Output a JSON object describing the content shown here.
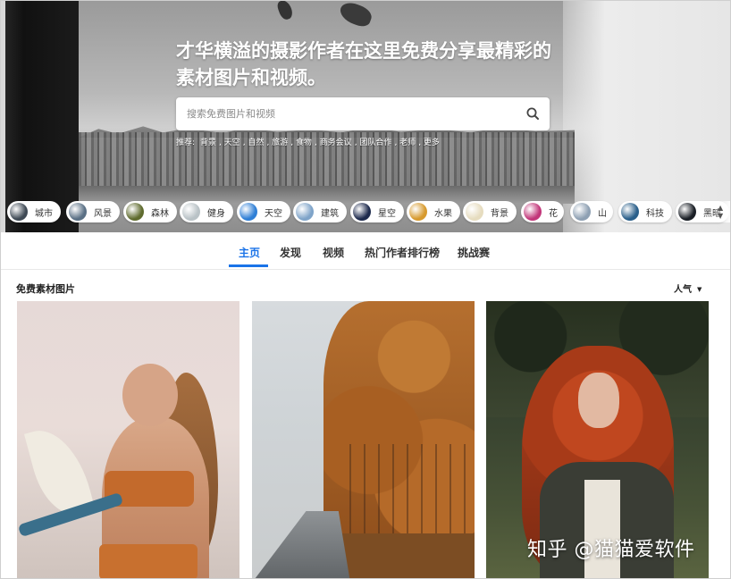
{
  "hero": {
    "title": "才华横溢的摄影作者在这里免费分享最精彩的素材图片和视频。"
  },
  "search": {
    "placeholder": "搜索免费图片和视频",
    "value": ""
  },
  "suggestions": {
    "prefix": "推荐:",
    "items": [
      "背景",
      "天空",
      "自然",
      "旅游",
      "食物",
      "商务会议",
      "团队合作",
      "老师",
      "更多"
    ]
  },
  "categories": [
    {
      "label": "城市",
      "color": "#3f4a55"
    },
    {
      "label": "风景",
      "color": "#5a7085"
    },
    {
      "label": "森林",
      "color": "#5f6b2e"
    },
    {
      "label": "健身",
      "color": "#b9c2c6"
    },
    {
      "label": "天空",
      "color": "#2f7fd6"
    },
    {
      "label": "建筑",
      "color": "#7fa4c9"
    },
    {
      "label": "星空",
      "color": "#1d2a4d"
    },
    {
      "label": "水果",
      "color": "#d79a2e"
    },
    {
      "label": "背景",
      "color": "#e6dcbf"
    },
    {
      "label": "花",
      "color": "#c2377a"
    },
    {
      "label": "山",
      "color": "#8ea0b3"
    },
    {
      "label": "科技",
      "color": "#2a5f8a"
    },
    {
      "label": "黑暗",
      "color": "#1a1f26"
    }
  ],
  "nav": {
    "tabs": [
      "主页",
      "发现",
      "视频",
      "热门作者排行榜",
      "挑战赛"
    ],
    "active": "主页"
  },
  "section": {
    "title": "免费素材图片",
    "sort_label": "人气"
  },
  "watermark": "知乎 @猫猫爱软件",
  "colors": {
    "accent": "#1a73e8"
  }
}
